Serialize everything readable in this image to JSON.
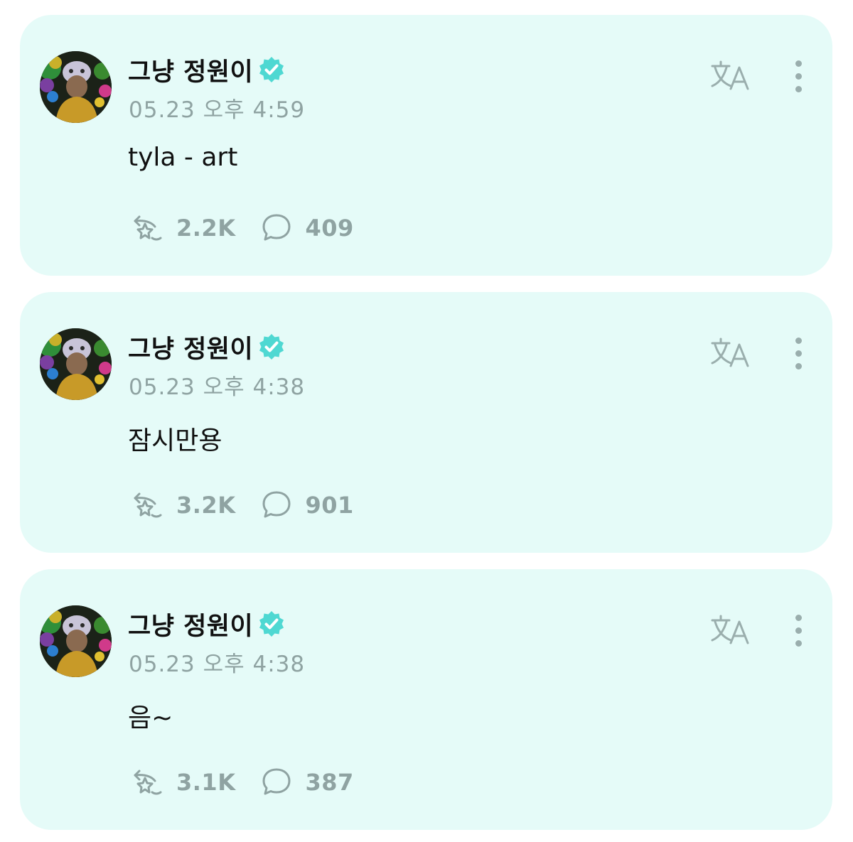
{
  "colors": {
    "card_background": "#e5fbf8",
    "verified_badge": "#4fd8d2",
    "muted_text": "#8fa3a2",
    "primary_text": "#111111"
  },
  "icons": {
    "verified": "verified-badge-icon",
    "translate": "translate-icon",
    "more": "more-vertical-icon",
    "repost": "repost-star-icon",
    "comment": "comment-bubble-icon"
  },
  "posts": [
    {
      "author": "그냥 정원이",
      "timestamp": "05.23 오후 4:59",
      "text": "tyla - art",
      "reposts": "2.2K",
      "comments": "409"
    },
    {
      "author": "그냥 정원이",
      "timestamp": "05.23 오후 4:38",
      "text": "잠시만용",
      "reposts": "3.2K",
      "comments": "901"
    },
    {
      "author": "그냥 정원이",
      "timestamp": "05.23 오후 4:38",
      "text": "음~",
      "reposts": "3.1K",
      "comments": "387"
    }
  ]
}
